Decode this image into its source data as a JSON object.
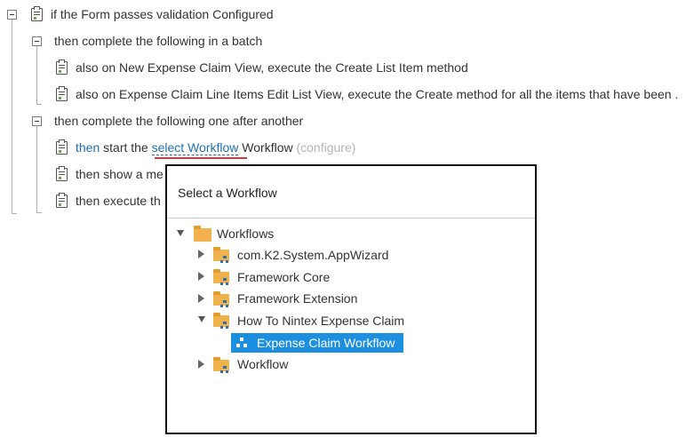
{
  "rules": {
    "r1": "if the Form passes validation Configured",
    "r2": "then complete the following in a batch",
    "r3": "also on New Expense Claim View, execute the Create List Item method",
    "r4": "also on Expense Claim Line Items Edit List View, execute the Create method for all the items that have been .",
    "r5": "then complete the following one after another",
    "r6": {
      "then": "then",
      "start_the": " start the ",
      "select_workflow": "select Workflow",
      "workflow": " Workflow ",
      "configure": "(configure)"
    },
    "r7": "then show a me",
    "r8": "then execute th"
  },
  "dialog": {
    "title": "Select a Workflow",
    "tree": {
      "root": "Workflows",
      "items": [
        "com.K2.System.AppWizard",
        "Framework Core",
        "Framework Extension",
        "How To Nintex Expense Claim",
        "Expense Claim Workflow",
        "Workflow"
      ]
    }
  },
  "colors": {
    "link": "#1f6fb2",
    "selection": "#1d8fe0",
    "folder": "#f0b24a",
    "highlight_underline": "#d93a3a"
  }
}
